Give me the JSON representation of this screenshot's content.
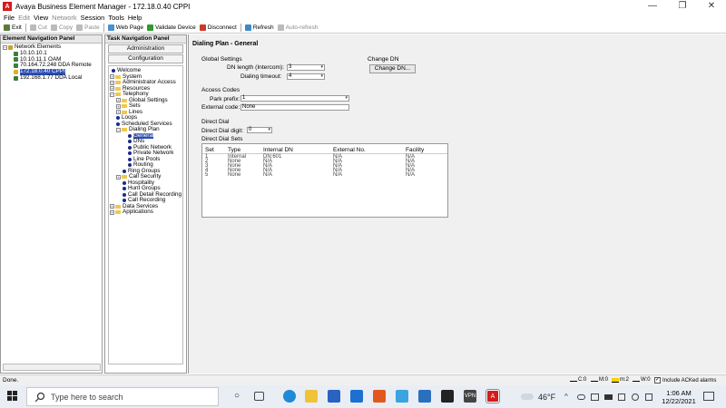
{
  "window": {
    "title": "Avaya Business Element Manager - 172.18.0.40 CPPI",
    "icon_letter": "A",
    "minimize_glyph": "—",
    "maximize_glyph": "❐",
    "close_glyph": "✕"
  },
  "menubar": {
    "items": [
      "File",
      "Edit",
      "View",
      "Network",
      "Session",
      "Tools",
      "Help"
    ]
  },
  "toolbar": {
    "exit": "Exit",
    "cut": "Cut",
    "copy": "Copy",
    "paste": "Paste",
    "web_page": "Web Page",
    "validate_device": "Validate Device",
    "disconnect": "Disconnect",
    "refresh": "Refresh",
    "auto_refresh": "Auto-refresh"
  },
  "left_panel": {
    "header": "Element Navigation Panel",
    "root": "Network Elements",
    "items": [
      "10.10.10.1",
      "10.10.11.1 OAM",
      "70.164.72.248 DDA Remote",
      "172.18.0.40 CPPI",
      "192.168.1.77 DDA Local"
    ]
  },
  "center_panel": {
    "header": "Task Navigation Panel",
    "tab_admin": "Administration",
    "tab_config": "Configuration",
    "tree": [
      "Welcome",
      "System",
      "Administrator Access",
      "Resources",
      "Telephony",
      "Global Settings",
      "Sets",
      "Lines",
      "Loops",
      "Scheduled Services",
      "Dialing Plan",
      "General",
      "DNs",
      "Public Network",
      "Private Network",
      "Line Pools",
      "Routing",
      "Ring Groups",
      "Call Security",
      "Hospitality",
      "Hunt Groups",
      "Call Detail Recording",
      "Call Recording",
      "Data Services",
      "Applications"
    ],
    "tree_sign_expand": "+",
    "tree_sign_collapse": "−"
  },
  "main": {
    "page_title": "Dialing Plan - General",
    "global_settings": {
      "heading": "Global Settings",
      "dn_length_label": "DN length (Intercom):",
      "dn_length_value": "3",
      "dialing_timeout_label": "Dialing timeout:",
      "dialing_timeout_value": "4"
    },
    "change_dn": {
      "heading": "Change DN",
      "button": "Change DN..."
    },
    "access_codes": {
      "heading": "Access Codes",
      "park_prefix_label": "Park prefix:",
      "park_prefix_value": "1",
      "external_code_label": "External code:",
      "external_code_value": "None"
    },
    "direct_dial": {
      "heading": "Direct Dial",
      "digit_label": "Direct Dial digit:",
      "digit_value": "0",
      "sets_label": "Direct Dial Sets"
    },
    "table": {
      "columns": [
        "Set",
        "Type",
        "Internal DN",
        "External No.",
        "Facility"
      ],
      "rows": [
        [
          "1",
          "Internal",
          "DN:601",
          "N/A",
          "N/A"
        ],
        [
          "2",
          "None",
          "N/A",
          "N/A",
          "N/A"
        ],
        [
          "3",
          "None",
          "N/A",
          "N/A",
          "N/A"
        ],
        [
          "4",
          "None",
          "N/A",
          "N/A",
          "N/A"
        ],
        [
          "5",
          "None",
          "N/A",
          "N/A",
          "N/A"
        ]
      ]
    },
    "dropdown_arrow": "▾"
  },
  "statusbar": {
    "text": "Done.",
    "c": "C:0",
    "m": "M:0",
    "mi": "m:2",
    "w": "W:0",
    "include_acked": "Include ACKed alarms",
    "checkbox_mark": "✓"
  },
  "taskbar": {
    "search_placeholder": "Type here to search",
    "weather": "46°F",
    "time": "1:06 AM",
    "date": "12/22/2021",
    "vpn_label": "VPN",
    "avaya_label": "A",
    "tray_up_glyph": "^"
  },
  "colors": {
    "accent": "#2b4fb5",
    "avaya_red": "#d71a1a"
  }
}
